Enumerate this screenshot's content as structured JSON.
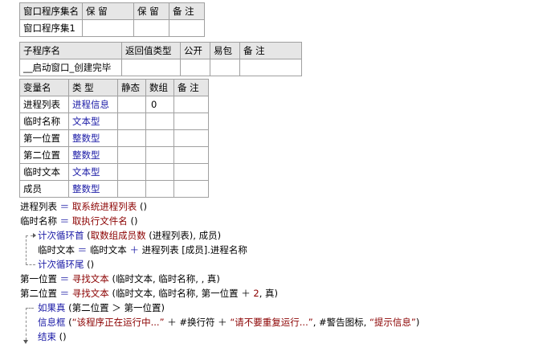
{
  "assembly_table": {
    "headers": [
      "窗口程序集名",
      "保 留",
      "保 留",
      "备 注"
    ],
    "rows": [
      [
        "窗口程序集1",
        "",
        "",
        ""
      ]
    ]
  },
  "sub_table": {
    "headers": [
      "子程序名",
      "返回值类型",
      "公开",
      "易包",
      "备 注"
    ],
    "rows": [
      [
        "__启动窗口_创建完毕",
        "",
        "",
        "",
        ""
      ]
    ]
  },
  "var_table": {
    "headers": [
      "变量名",
      "类 型",
      "静态",
      "数组",
      "备 注"
    ],
    "rows": [
      [
        "进程列表",
        "进程信息",
        "",
        "0",
        ""
      ],
      [
        "临时名称",
        "文本型",
        "",
        "",
        ""
      ],
      [
        "第一位置",
        "整数型",
        "",
        "",
        ""
      ],
      [
        "第二位置",
        "整数型",
        "",
        "",
        ""
      ],
      [
        "临时文本",
        "文本型",
        "",
        "",
        ""
      ],
      [
        "成员",
        "整数型",
        "",
        "",
        ""
      ]
    ]
  },
  "code": {
    "l1": {
      "a": "进程列表",
      "b": " ＝ ",
      "c": "取系统进程列表",
      "d": " ()"
    },
    "l2": {
      "a": "临时名称",
      "b": " ＝ ",
      "c": "取执行文件名",
      "d": " ()"
    },
    "l3": {
      "a": "计次循环首",
      "b": " (",
      "c": "取数组成员数",
      "d": " (进程列表), 成员)"
    },
    "l4": {
      "a": "临时文本",
      "b": " ＝ ",
      "c": "临时文本",
      "d": " ＋ ",
      "e": "进程列表 [成员].进程名称"
    },
    "l5": {
      "a": "计次循环尾",
      "b": " ()"
    },
    "l6": {
      "a": "第一位置",
      "b": " ＝ ",
      "c": "寻找文本",
      "d": " (临时文本, 临时名称, , 真)"
    },
    "l7": {
      "a": "第二位置",
      "b": " ＝ ",
      "c": "寻找文本",
      "d": " (临时文本, 临时名称, 第一位置 ＋ ",
      "e": "2",
      "f": ", 真)"
    },
    "l8": {
      "a": "如果真",
      "b": " (第二位置 ＞ 第一位置)"
    },
    "l9": {
      "a": "信息框",
      "b": " (",
      "c": "“该程序正在运行中...”",
      "d": " ＋ #换行符 ＋ ",
      "e": "“请不要重复运行...”",
      "f": ", #警告图标, ",
      "g": "“提示信息”",
      "h": ")"
    },
    "l10": {
      "a": "结束",
      "b": " ()"
    }
  },
  "colors": {
    "keyword_blue": "#1a1aa6",
    "function_red": "#8b0000",
    "header_gray": "#e6e6e6"
  }
}
